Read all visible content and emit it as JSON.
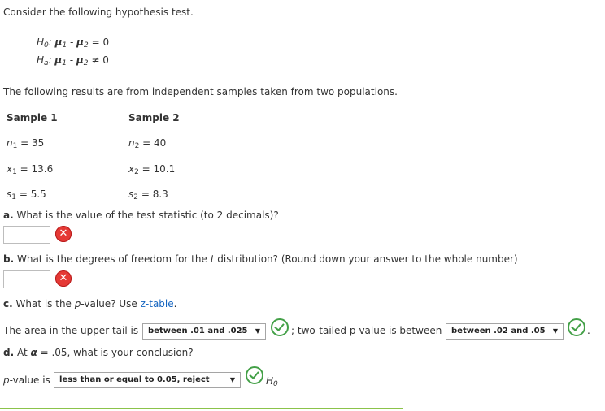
{
  "intro": "Consider the following hypothesis test.",
  "h0": {
    "label_main": "H",
    "label_sub": "0",
    "mu": "μ",
    "sub1": "1",
    "sub2": "2",
    "rel": "= 0"
  },
  "ha": {
    "label_main": "H",
    "label_sub": "a",
    "mu": "μ",
    "sub1": "1",
    "sub2": "2",
    "rel": "≠ 0"
  },
  "results_text": "The following results are from independent samples taken from two populations.",
  "sample1": {
    "header": "Sample 1",
    "n": {
      "var": "n",
      "sub": "1",
      "value": "= 35"
    },
    "xbar": {
      "var": "x",
      "sub": "1",
      "value": "= 13.6"
    },
    "s": {
      "var": "s",
      "sub": "1",
      "value": "= 5.5"
    }
  },
  "sample2": {
    "header": "Sample 2",
    "n": {
      "var": "n",
      "sub": "2",
      "value": "= 40"
    },
    "xbar": {
      "var": "x",
      "sub": "2",
      "value": "= 10.1"
    },
    "s": {
      "var": "s",
      "sub": "2",
      "value": "= 8.3"
    }
  },
  "qa": {
    "letter": "a.",
    "text": "What is the value of the test statistic (to 2 decimals)?",
    "answer": ""
  },
  "qb": {
    "letter": "b.",
    "text_before": "What is the degrees of freedom for the",
    "t": "t",
    "text_after": "distribution? (Round down your answer to the whole number)",
    "answer": ""
  },
  "qc": {
    "letter": "c.",
    "text_before": "What is the",
    "p": "p",
    "text_mid": "-value? Use",
    "link": "z-table",
    "text_end": "."
  },
  "area": {
    "before": "The area in the upper tail is",
    "dropdown": "between .01 and .025",
    "after": "; two-tailed p-value is between",
    "dropdown2": "between .02 and .05",
    "period": "."
  },
  "qd": {
    "letter": "d.",
    "text_before": "At",
    "alpha": "α",
    "text_after": "= .05, what is your conclusion?"
  },
  "conclusion": {
    "p": "p",
    "before": "-value is",
    "dropdown": "less than or equal to 0.05, reject",
    "h": "H",
    "h_sub": "0"
  },
  "icons": {
    "wrong": "x-icon",
    "right": "checkmark-icon",
    "arrow": "▼",
    "wrong_color": "#e53935",
    "right_color": "#43a047"
  }
}
